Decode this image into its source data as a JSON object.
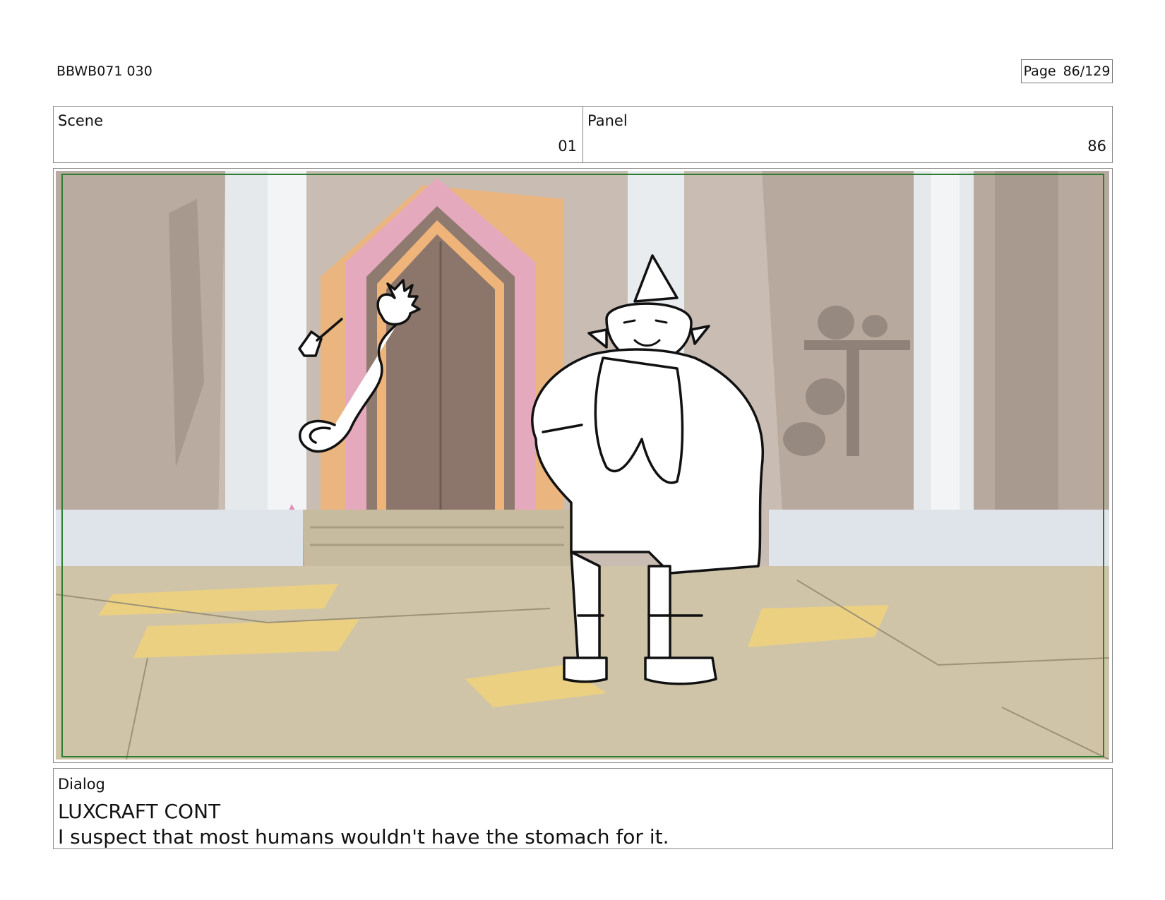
{
  "header": {
    "doc_id": "BBWB071 030",
    "page_label": "Page",
    "page_number": "86/129"
  },
  "info": {
    "scene_label": "Scene",
    "scene_value": "01",
    "panel_label": "Panel",
    "panel_value": "86"
  },
  "dialog": {
    "label": "Dialog",
    "speaker": "LUXCRAFT CONT",
    "line": "I suspect that most humans wouldn't have the stomach for it."
  },
  "colors": {
    "safe_frame": "#2e7d32",
    "floor": "#cfc4a8",
    "floor_patch": "#f1d27a",
    "wall_rock": "#b6a89d",
    "pillar": "#e9ecef",
    "arch_pink": "#e5a9bd",
    "arch_orange": "#eeb47a",
    "door": "#8f7a70"
  }
}
